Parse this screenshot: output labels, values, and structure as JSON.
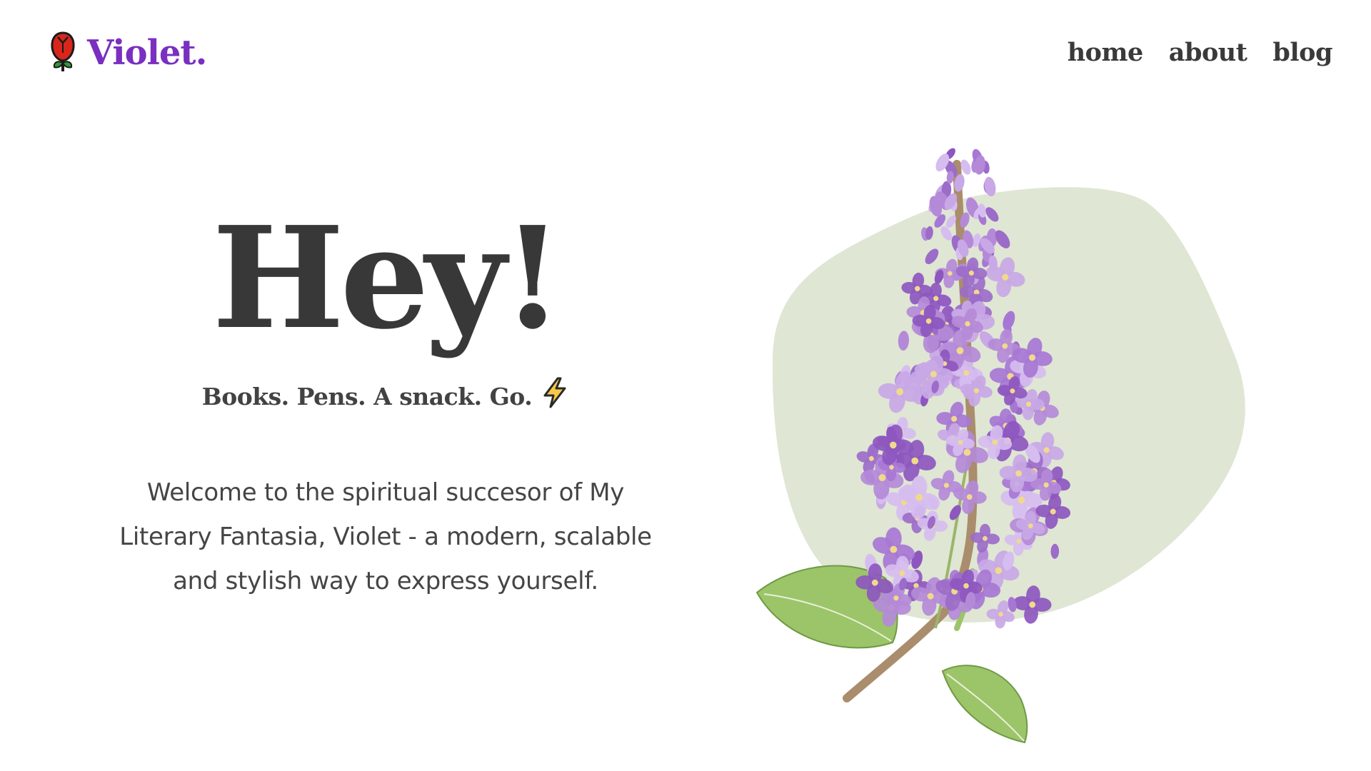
{
  "header": {
    "brand": {
      "name": "Violet.",
      "logo_icon": "rose-icon"
    },
    "nav": [
      {
        "label": "home"
      },
      {
        "label": "about"
      },
      {
        "label": "blog"
      }
    ]
  },
  "hero": {
    "title": "Hey!",
    "tagline": "Books. Pens. A snack. Go.",
    "tagline_icon": "lightning-bolt-icon",
    "body": "Welcome to the spiritual succesor of My Literary Fantasia, Violet - a modern, scalable and stylish way to express yourself."
  },
  "illustration": {
    "subject": "lilac-flower-illustration",
    "blob_color": "#dfe6d3"
  },
  "colors": {
    "brand": "#7a2fc0",
    "text": "#3a3a3a",
    "background": "#ffffff",
    "blob": "#dfe6d3"
  }
}
